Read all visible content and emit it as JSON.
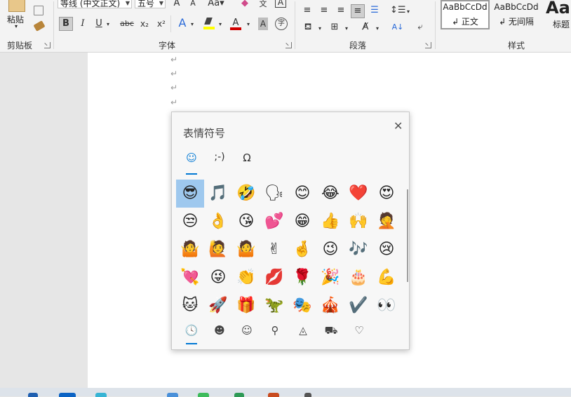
{
  "ribbon": {
    "clipboard": {
      "label": "剪贴板",
      "paste_label": "粘贴"
    },
    "font": {
      "label": "字体",
      "font_name": "等线 (中文正文)",
      "font_size": "五号",
      "buttons": [
        "B",
        "I",
        "U",
        "abc",
        "x₂",
        "x²"
      ]
    },
    "paragraph": {
      "label": "段落"
    },
    "styles": {
      "label": "样式",
      "items": [
        {
          "preview": "AaBbCcDd",
          "name": "↲ 正文"
        },
        {
          "preview": "AaBbCcDd",
          "name": "↲ 无间隔"
        },
        {
          "preview": "Aa",
          "name": "标题"
        }
      ]
    },
    "colors": {
      "highlight": "#ffff00",
      "font_color": "#d00000",
      "accent": "#0078d4"
    }
  },
  "document": {
    "paragraph_mark": "↵"
  },
  "emoji_panel": {
    "title": "表情符号",
    "close_label": "✕",
    "tabs": [
      {
        "icon": "emoji-tab-icon",
        "glyph": "☺"
      },
      {
        "icon": "kaomoji-tab-icon",
        "glyph": ";-)"
      },
      {
        "icon": "symbols-tab-icon",
        "glyph": "Ω"
      }
    ],
    "emoji_rows": [
      [
        "😎",
        "🎵",
        "🤣",
        "🗣",
        "😊",
        "😂",
        "❤️",
        "😍"
      ],
      [
        "😒",
        "👌",
        "😘",
        "💕",
        "😁",
        "👍",
        "🙌",
        "🤦"
      ],
      [
        "🤷",
        "🙋",
        "🤷",
        "✌",
        "🤞",
        "😉",
        "🎶",
        "😢"
      ],
      [
        "💘",
        "😜",
        "👏",
        "💋",
        "🌹",
        "🎉",
        "🎂",
        "💪"
      ],
      [
        "🐱",
        "🚀",
        "🎁",
        "🦖",
        "🎭",
        "🎪",
        "✔️",
        "👀"
      ]
    ],
    "categories": [
      {
        "icon": "recent-clock-icon",
        "glyph": "🕓"
      },
      {
        "icon": "smiley-faces-icon",
        "glyph": "☻"
      },
      {
        "icon": "people-icon",
        "glyph": "☺"
      },
      {
        "icon": "celebration-balloon-icon",
        "glyph": "⚲"
      },
      {
        "icon": "food-pizza-icon",
        "glyph": "◬"
      },
      {
        "icon": "travel-car-icon",
        "glyph": "⛟"
      },
      {
        "icon": "symbols-heart-icon",
        "glyph": "♡"
      }
    ]
  }
}
